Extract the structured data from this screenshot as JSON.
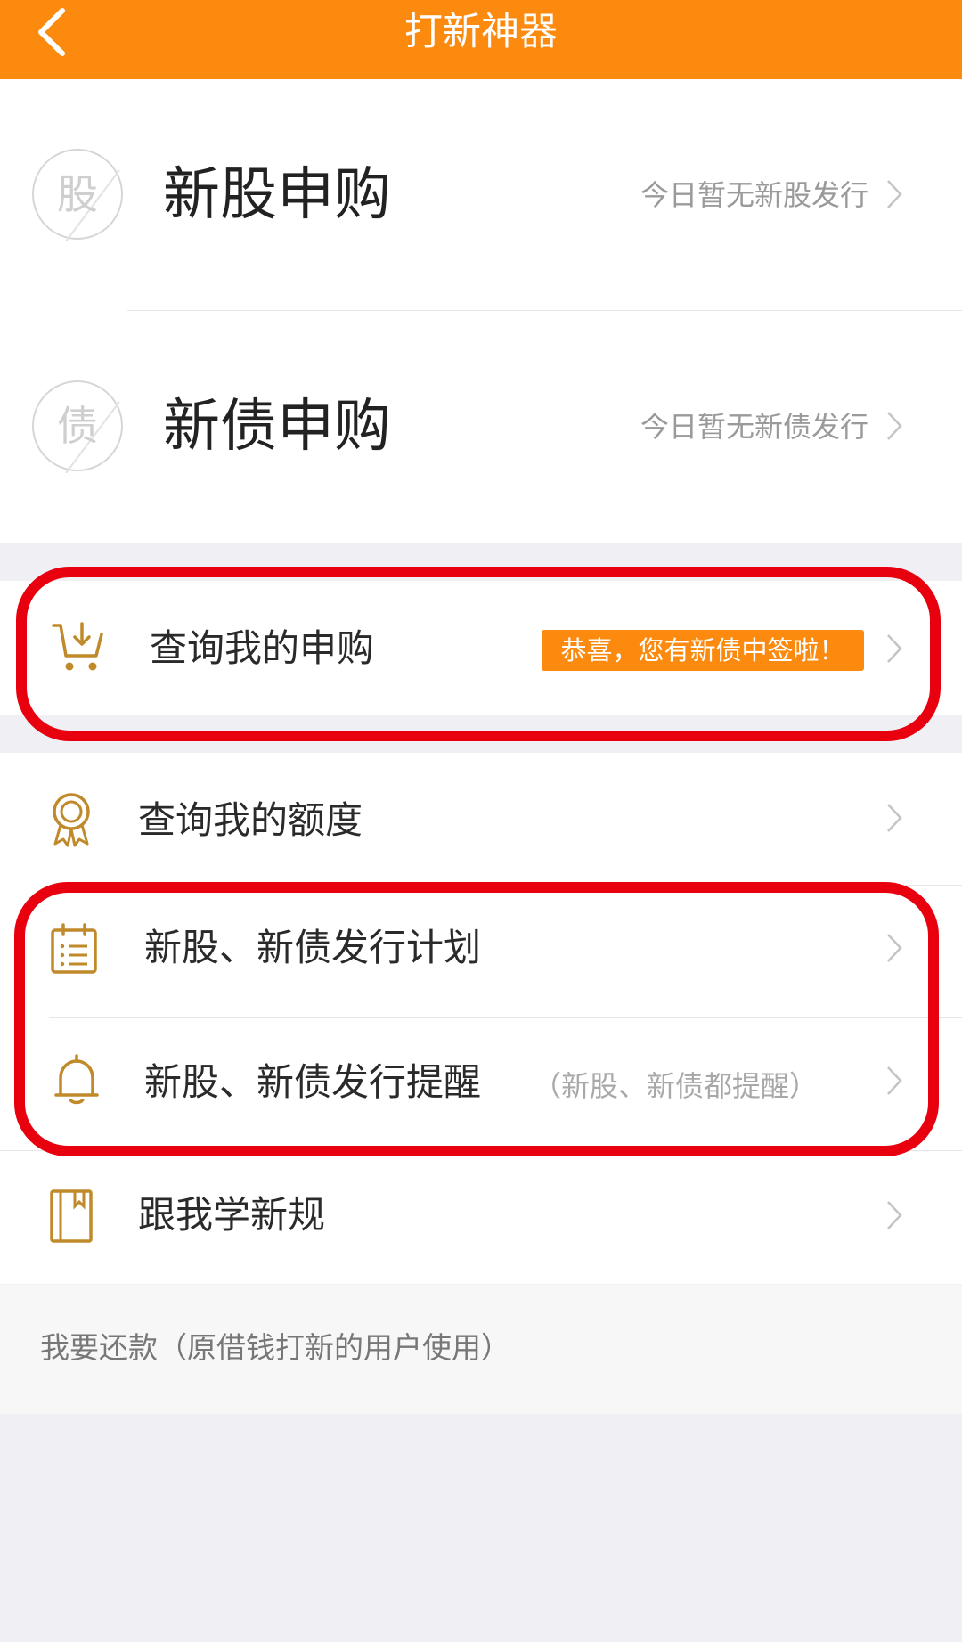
{
  "header": {
    "title": "打新神器",
    "back_icon": "chevron-left-icon"
  },
  "subscribe": [
    {
      "seal": "股",
      "title": "新股申购",
      "status": "今日暂无新股发行"
    },
    {
      "seal": "债",
      "title": "新债申购",
      "status": "今日暂无新债发行"
    }
  ],
  "query": {
    "label": "查询我的申购",
    "badge": "恭喜，您有新债中签啦！",
    "icon": "cart-download-icon"
  },
  "menu": [
    {
      "label": "查询我的额度",
      "icon": "award-ribbon-icon",
      "note": ""
    },
    {
      "label": "新股、新债发行计划",
      "icon": "calendar-list-icon",
      "note": ""
    },
    {
      "label": "新股、新债发行提醒",
      "icon": "bell-icon",
      "note": "（新股、新债都提醒）"
    },
    {
      "label": "跟我学新规",
      "icon": "notebook-icon",
      "note": ""
    }
  ],
  "repay": {
    "label": "我要还款（原借钱打新的用户使用）"
  },
  "colors": {
    "accent": "#fb8a0e",
    "highlight": "#e8000f",
    "icon_gold": "#c08a2a"
  }
}
